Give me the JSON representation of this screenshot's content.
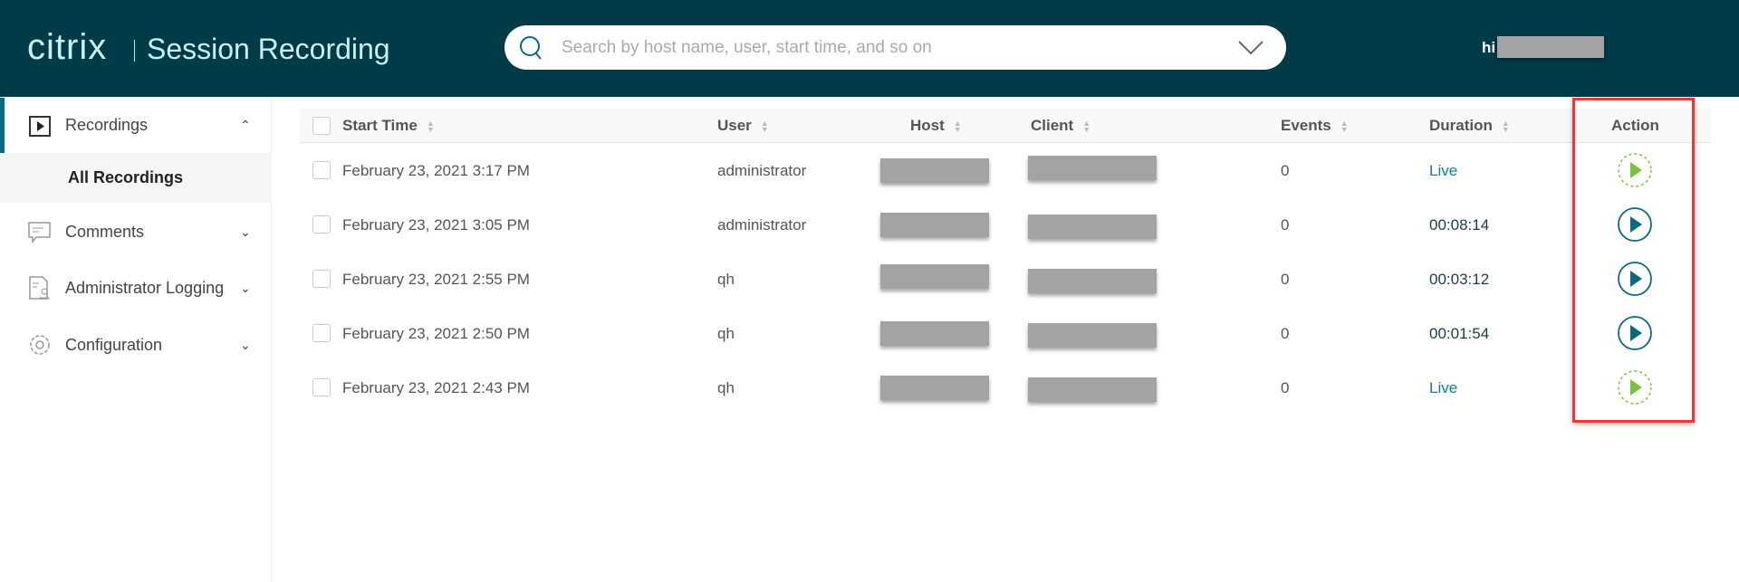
{
  "header": {
    "logo": "citrix",
    "app_title": "Session Recording",
    "search_placeholder": "Search by host name, user, start time, and so on",
    "greeting": "hi"
  },
  "sidebar": {
    "items": [
      {
        "label": "Recordings",
        "icon": "play-box-icon",
        "expanded": true
      },
      {
        "label": "All Recordings",
        "selected": true
      },
      {
        "label": "Comments",
        "icon": "comment-icon"
      },
      {
        "label": "Administrator Logging",
        "icon": "admin-log-icon"
      },
      {
        "label": "Configuration",
        "icon": "gear-icon"
      }
    ]
  },
  "table": {
    "columns": [
      "Start Time",
      "User",
      "Host",
      "Client",
      "Events",
      "Duration",
      "Action"
    ],
    "rows": [
      {
        "start_time": "February 23, 2021 3:17 PM",
        "user": "administrator",
        "events": "0",
        "duration": "Live",
        "live": true
      },
      {
        "start_time": "February 23, 2021 3:05 PM",
        "user": "administrator",
        "events": "0",
        "duration": "00:08:14",
        "live": false
      },
      {
        "start_time": "February 23, 2021 2:55 PM",
        "user": "qh",
        "events": "0",
        "duration": "00:03:12",
        "live": false
      },
      {
        "start_time": "February 23, 2021 2:50 PM",
        "user": "qh",
        "events": "0",
        "duration": "00:01:54",
        "live": false
      },
      {
        "start_time": "February 23, 2021 2:43 PM",
        "user": "qh",
        "events": "0",
        "duration": "Live",
        "live": true
      }
    ]
  },
  "colors": {
    "header": "#023b48",
    "accent": "#0b6a7e",
    "live": "#7cc242",
    "highlight": "#e83a3a"
  }
}
